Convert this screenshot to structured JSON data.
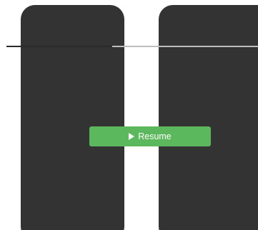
{
  "overlay": {
    "icon": "pause-icon",
    "bar_color": "#333333"
  },
  "progress": {
    "value_fraction": 0.42,
    "track_color": "#bdbdbd",
    "fill_color": "#2b2b2b"
  },
  "resume_button": {
    "label": "Resume",
    "icon": "play-icon",
    "color": "#5cb85c"
  }
}
